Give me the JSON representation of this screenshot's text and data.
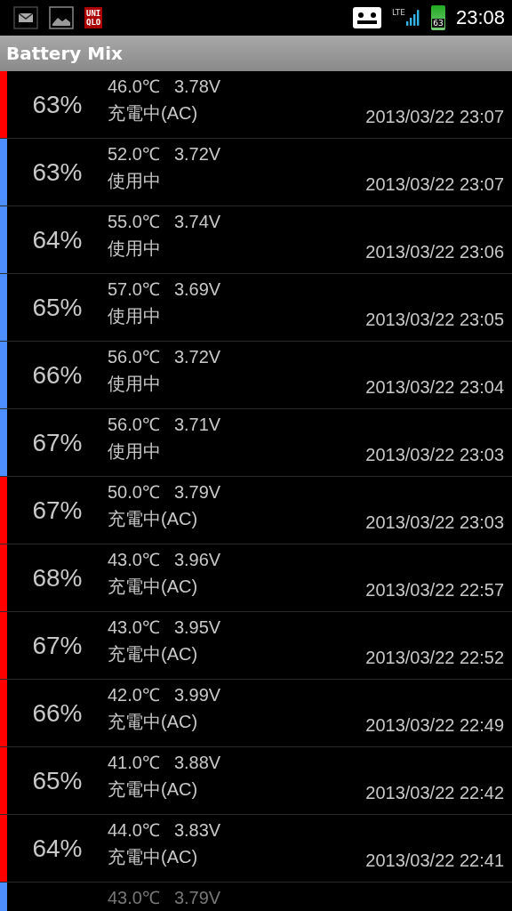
{
  "status_bar": {
    "app_badge": [
      "UNI",
      "QLO"
    ],
    "network": "LTE",
    "battery": "63",
    "time": "23:08"
  },
  "title": "Battery Mix",
  "rows": [
    {
      "percent": "63%",
      "temp": "46.0℃",
      "volt": "3.78V",
      "status": "充電中(AC)",
      "time": "2013/03/22 23:07",
      "color": "#ff0000"
    },
    {
      "percent": "63%",
      "temp": "52.0℃",
      "volt": "3.72V",
      "status": "使用中",
      "time": "2013/03/22 23:07",
      "color": "#4d8fff"
    },
    {
      "percent": "64%",
      "temp": "55.0℃",
      "volt": "3.74V",
      "status": "使用中",
      "time": "2013/03/22 23:06",
      "color": "#4d8fff"
    },
    {
      "percent": "65%",
      "temp": "57.0℃",
      "volt": "3.69V",
      "status": "使用中",
      "time": "2013/03/22 23:05",
      "color": "#4d8fff"
    },
    {
      "percent": "66%",
      "temp": "56.0℃",
      "volt": "3.72V",
      "status": "使用中",
      "time": "2013/03/22 23:04",
      "color": "#4d8fff"
    },
    {
      "percent": "67%",
      "temp": "56.0℃",
      "volt": "3.71V",
      "status": "使用中",
      "time": "2013/03/22 23:03",
      "color": "#4d8fff"
    },
    {
      "percent": "67%",
      "temp": "50.0℃",
      "volt": "3.79V",
      "status": "充電中(AC)",
      "time": "2013/03/22 23:03",
      "color": "#ff0000"
    },
    {
      "percent": "68%",
      "temp": "43.0℃",
      "volt": "3.96V",
      "status": "充電中(AC)",
      "time": "2013/03/22 22:57",
      "color": "#ff0000"
    },
    {
      "percent": "67%",
      "temp": "43.0℃",
      "volt": "3.95V",
      "status": "充電中(AC)",
      "time": "2013/03/22 22:52",
      "color": "#ff0000"
    },
    {
      "percent": "66%",
      "temp": "42.0℃",
      "volt": "3.99V",
      "status": "充電中(AC)",
      "time": "2013/03/22 22:49",
      "color": "#ff0000"
    },
    {
      "percent": "65%",
      "temp": "41.0℃",
      "volt": "3.88V",
      "status": "充電中(AC)",
      "time": "2013/03/22 22:42",
      "color": "#ff0000"
    },
    {
      "percent": "64%",
      "temp": "44.0℃",
      "volt": "3.83V",
      "status": "充電中(AC)",
      "time": "2013/03/22 22:41",
      "color": "#ff0000"
    },
    {
      "temp": "43.0℃",
      "volt": "3.79V",
      "color": "#4d8fff"
    }
  ]
}
